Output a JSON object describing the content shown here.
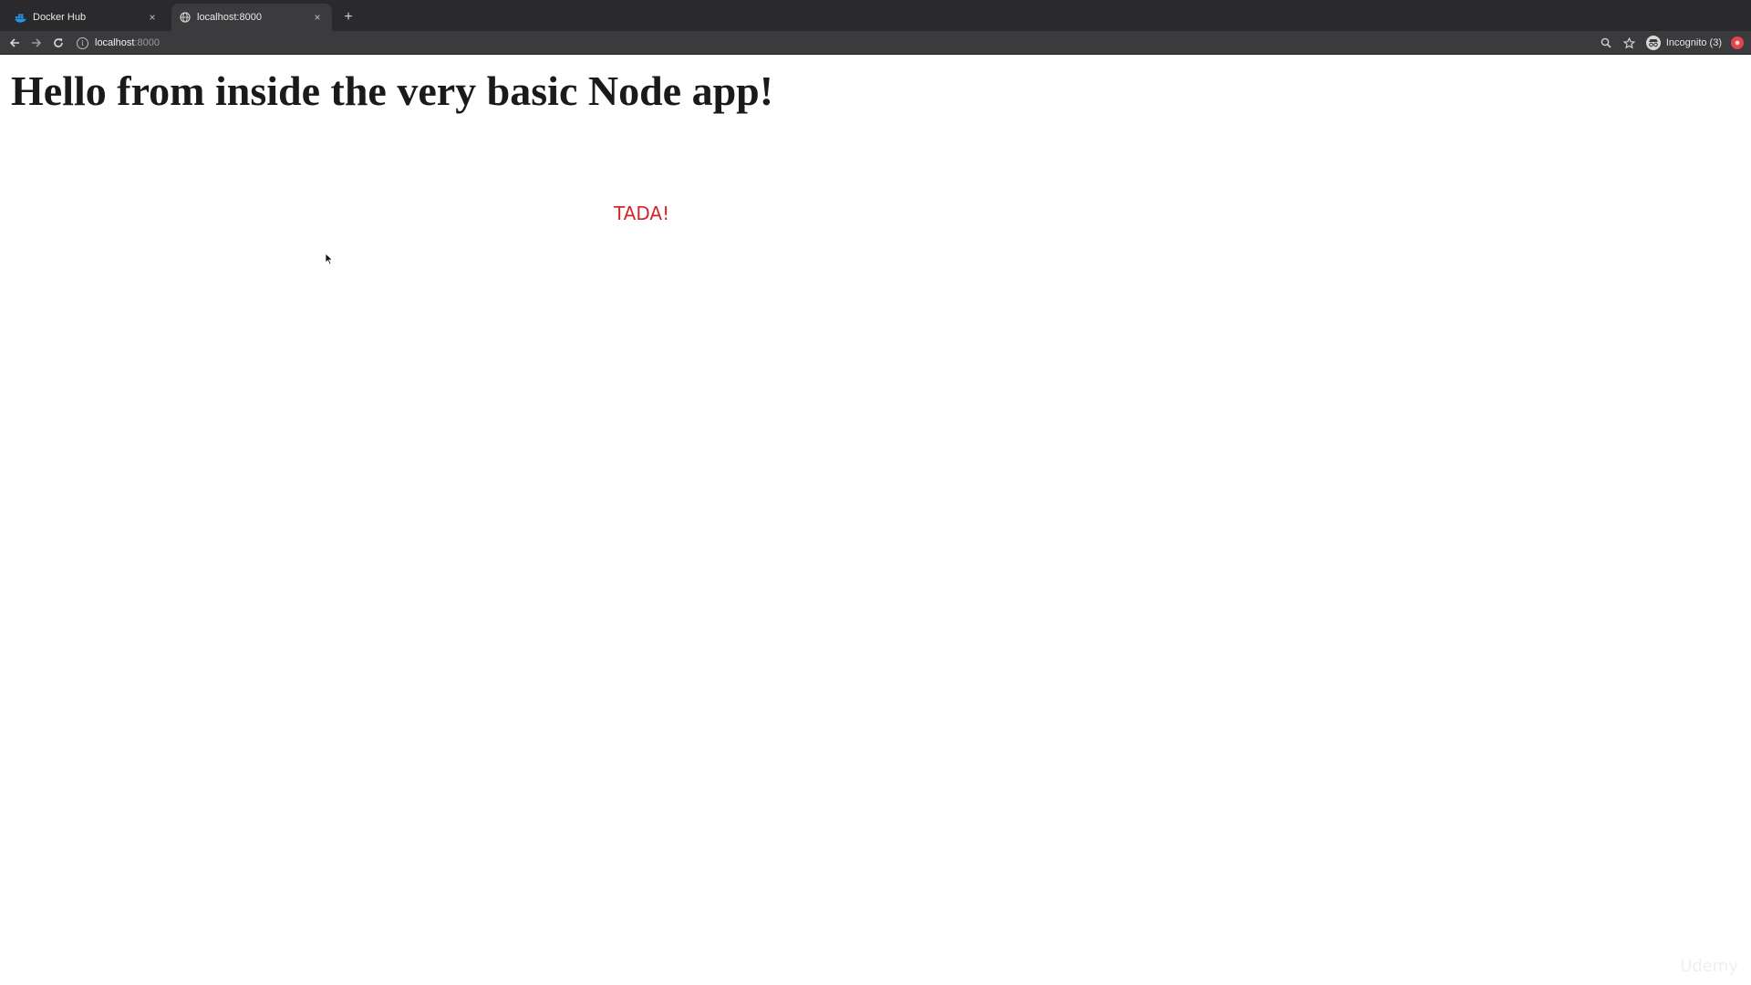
{
  "browser": {
    "tabs": [
      {
        "title": "Docker Hub",
        "active": false
      },
      {
        "title": "localhost:8000",
        "active": true
      }
    ],
    "new_tab_glyph": "+",
    "close_glyph": "×",
    "address": {
      "host": "localhost",
      "port": ":8000"
    },
    "profile_label": "Incognito (3)",
    "icons": {
      "back": "arrow-left-icon",
      "forward": "arrow-right-icon",
      "reload": "reload-icon",
      "site_info": "info-icon",
      "zoom": "zoom-icon",
      "bookmark": "star-icon",
      "incognito": "incognito-icon",
      "profile": "profile-icon"
    },
    "colors": {
      "tabstrip": "#2a2a2c",
      "toolbar": "#3b3b3e"
    }
  },
  "page": {
    "heading": "Hello from inside the very basic Node app!",
    "tada": "TADA!",
    "tada_color": "#d4262a"
  },
  "watermark": "Udemy"
}
